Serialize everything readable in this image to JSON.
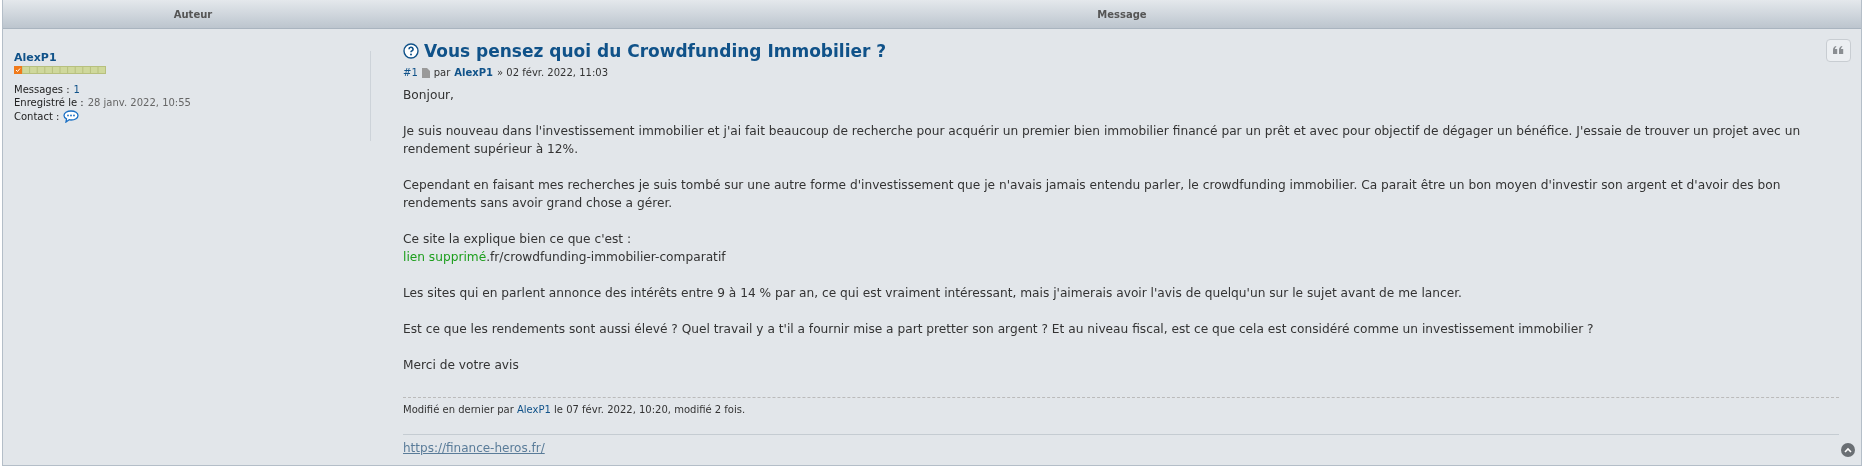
{
  "columns": [
    "Auteur",
    "Message"
  ],
  "author": {
    "name": "AlexP1",
    "stats": [
      {
        "label": "Messages :",
        "value": "1",
        "kind": "link"
      },
      {
        "label": "Enregistré le :",
        "value": "28 janv. 2022, 10:55",
        "kind": "text"
      },
      {
        "label": "Contact :",
        "kind": "contact"
      }
    ]
  },
  "post": {
    "title": "Vous pensez quoi du Crowdfunding Immobilier ?",
    "number": "#1",
    "by": "par",
    "author": "AlexP1",
    "date": "» 02 févr. 2022, 11:03",
    "paragraphs": [
      {
        "lines": [
          {
            "kind": "text",
            "text": "Bonjour,"
          }
        ]
      },
      {
        "lines": [
          {
            "kind": "text",
            "text": "Je suis nouveau dans l'investissement immobilier et j'ai fait beaucoup de recherche pour acquérir un premier bien immobilier financé par un prêt et avec pour objectif de dégager un bénéfice. J'essaie de trouver un projet avec un rendement supérieur à 12%."
          }
        ]
      },
      {
        "lines": [
          {
            "kind": "text",
            "text": "Cependant en faisant mes recherches je suis tombé sur une autre forme d'investissement que je n'avais jamais entendu parler, le crowdfunding immobilier. Ca parait être un bon moyen d'investir son argent et d'avoir des bon rendements sans avoir grand chose a gérer."
          }
        ]
      },
      {
        "lines": [
          {
            "kind": "text",
            "text": "Ce site la explique bien ce que c'est :"
          },
          {
            "kind": "removed_link",
            "label": "lien supprimé",
            "rest": ".fr/crowdfunding-immobilier-comparatif"
          }
        ]
      },
      {
        "lines": [
          {
            "kind": "text",
            "text": "Les sites qui en parlent annonce des intérêts entre 9 à 14 % par an, ce qui est vraiment intéressant, mais j'aimerais avoir l'avis de quelqu'un sur le sujet avant de me lancer."
          }
        ]
      },
      {
        "lines": [
          {
            "kind": "text",
            "text": "Est ce que les rendements sont aussi élevé ? Quel travail y a t'il a fournir mise a part pretter son argent ? Et au niveau fiscal, est ce que cela est considéré comme un investissement immobilier ?"
          }
        ]
      },
      {
        "lines": [
          {
            "kind": "text",
            "text": "Merci de votre avis"
          }
        ]
      }
    ],
    "edited": {
      "before": "Modifié en dernier par",
      "user": "AlexP1",
      "after": "le 07 févr. 2022, 10:20, modifié 2 fois."
    },
    "signature": "https://finance-heros.fr/"
  }
}
